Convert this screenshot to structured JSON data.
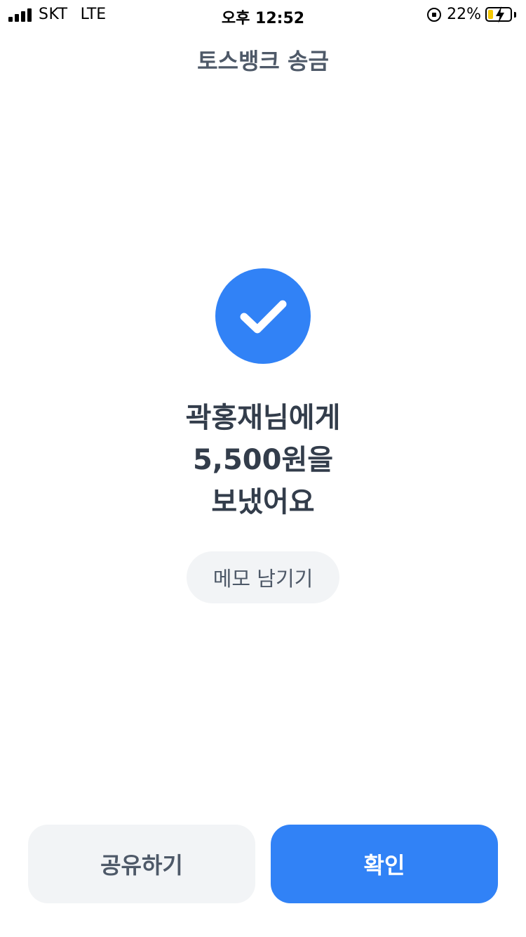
{
  "status_bar": {
    "carrier": "SKT",
    "network": "LTE",
    "time": "오후 12:52",
    "battery_percent": "22%",
    "battery_level": 0.22,
    "battery_fill_color": "#f5c800"
  },
  "header": {
    "title": "토스뱅크 송금"
  },
  "result": {
    "icon": "check-icon",
    "accent_color": "#3182f6",
    "line1": "곽홍재님에게",
    "line2": "5,500원을",
    "line3": "보냈어요"
  },
  "memo": {
    "label": "메모 남기기"
  },
  "actions": {
    "share_label": "공유하기",
    "confirm_label": "확인"
  }
}
